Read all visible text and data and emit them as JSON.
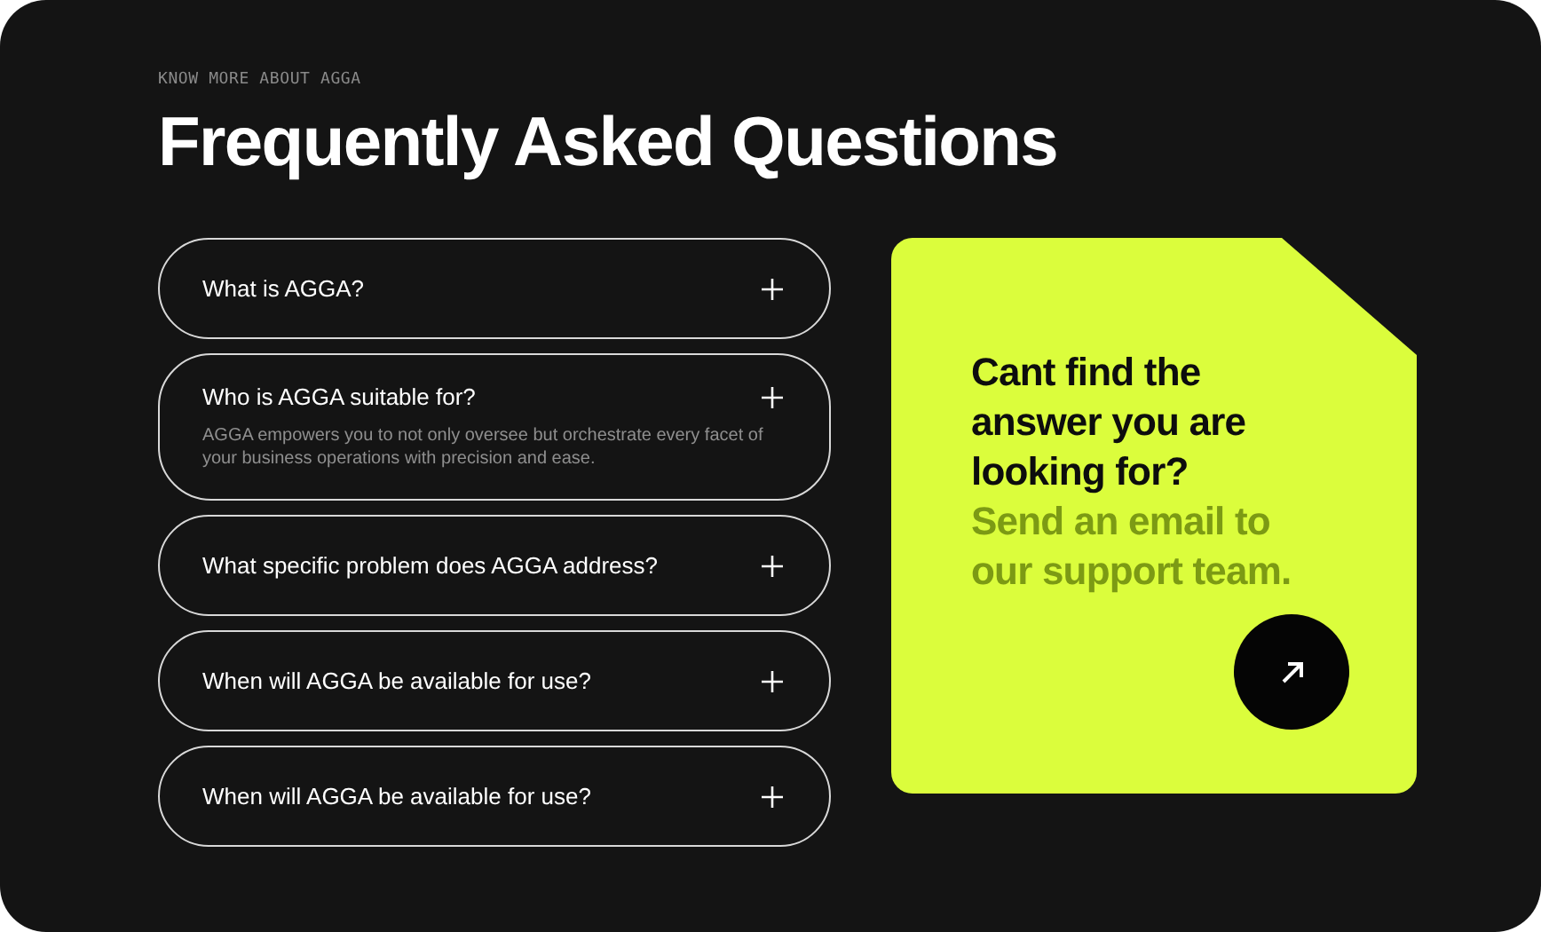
{
  "eyebrow": "KNOW MORE ABOUT AGGA",
  "title": "Frequently Asked Questions",
  "faq": [
    {
      "question": "What is AGGA?",
      "expanded": false
    },
    {
      "question": "Who is AGGA suitable for?",
      "expanded": true,
      "answer": "AGGA empowers you to not only oversee but orchestrate every facet of your business operations with precision and ease."
    },
    {
      "question": "What specific problem does AGGA address?",
      "expanded": false
    },
    {
      "question": "When will AGGA be available for use?",
      "expanded": false
    },
    {
      "question": "When will AGGA be available for use?",
      "expanded": false
    }
  ],
  "contact_card": {
    "heading": "Cant find the answer you are looking for?",
    "subheading": "Send an email to our support team."
  }
}
